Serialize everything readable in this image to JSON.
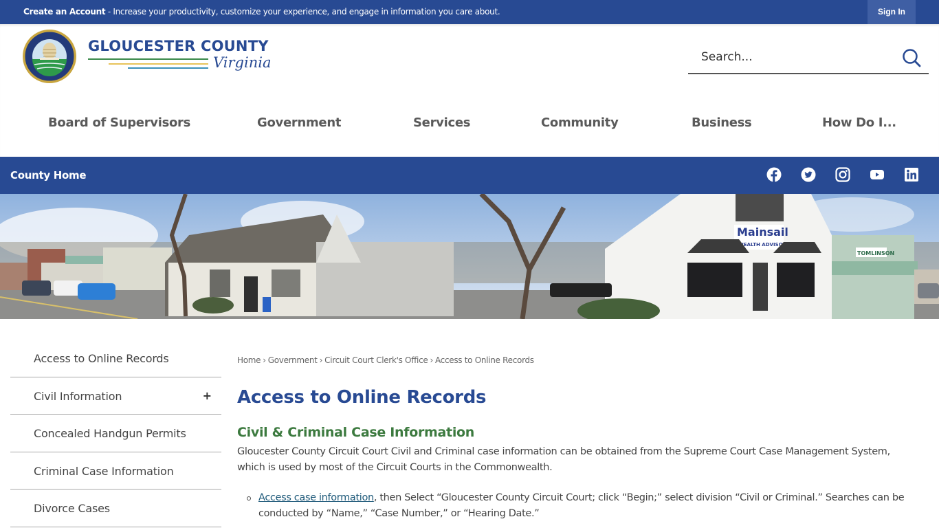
{
  "topbar": {
    "create_account": "Create an Account",
    "message": " - Increase your productivity, customize your experience, and engage in information you care about.",
    "sign_in": "Sign In"
  },
  "header": {
    "logo_title": "GLOUCESTER COUNTY",
    "logo_subtitle": "Virginia",
    "seal_alt": "Gloucester County Virginia Estab. 1651 seal",
    "search_placeholder": "Search..."
  },
  "main_nav": [
    {
      "label": "Board of Supervisors"
    },
    {
      "label": "Government"
    },
    {
      "label": "Services"
    },
    {
      "label": "Community"
    },
    {
      "label": "Business"
    },
    {
      "label": "How Do I..."
    }
  ],
  "bluebar": {
    "county_home": "County Home",
    "social": [
      {
        "name": "facebook-icon"
      },
      {
        "name": "twitter-icon"
      },
      {
        "name": "instagram-icon"
      },
      {
        "name": "youtube-icon"
      },
      {
        "name": "linkedin-icon"
      }
    ]
  },
  "banner": {
    "signs": [
      "Mainsail",
      "WEALTH ADVISORS",
      "TOMLINSON"
    ]
  },
  "sidebar": {
    "items": [
      {
        "label": "Access to Online Records",
        "expandable": false
      },
      {
        "label": "Civil Information",
        "expandable": true,
        "toggle": "+"
      },
      {
        "label": "Concealed Handgun Permits",
        "expandable": false
      },
      {
        "label": "Criminal Case Information",
        "expandable": false
      },
      {
        "label": "Divorce Cases",
        "expandable": false
      }
    ]
  },
  "breadcrumb": {
    "items": [
      "Home",
      "Government",
      "Circuit Court Clerk's Office",
      "Access to Online Records"
    ],
    "separator": "›"
  },
  "content": {
    "title": "Access to Online Records",
    "section_title": "Civil & Criminal Case Information",
    "paragraph": "Gloucester County Circuit Court Civil and Criminal case information can be obtained from the Supreme Court Case Management System, which is used by most of the Circuit Courts in the Commonwealth.",
    "bullet_link": "Access case information",
    "bullet_text": ", then Select “Gloucester County Circuit Court; click “Begin;” select division “Civil or Criminal.” Searches can be conducted by “Name,” “Case Number,” or “Hearing Date.”"
  },
  "colors": {
    "brand_blue": "#284a93",
    "heading_green": "#3c7a3f",
    "nav_gray": "#5a5a5a"
  }
}
